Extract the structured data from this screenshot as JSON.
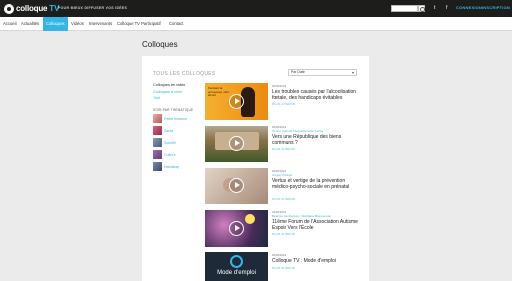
{
  "header": {
    "logo_text": "colloque",
    "logo_tv": "TV",
    "tagline": "POUR MIEUX DIFFUSER VOS IDÉES",
    "search_placeholder": "",
    "social": {
      "twitter": "t",
      "facebook": "f"
    },
    "login": "CONNEXION",
    "signup": "INSCRIPTION"
  },
  "nav": {
    "items": [
      {
        "label": "Accueil",
        "active": false
      },
      {
        "label": "Actualités",
        "active": false
      },
      {
        "label": "Colloques",
        "active": true
      },
      {
        "label": "Vidéos",
        "active": false
      },
      {
        "label": "Intervenants",
        "active": false
      },
      {
        "label": "Colloque TV Participatif",
        "active": false
      },
      {
        "label": "Contact",
        "active": false
      }
    ]
  },
  "page": {
    "title": "Colloques",
    "section_title": "TOUS LES COLLOQUES",
    "sort": {
      "selected": "Par Date"
    }
  },
  "sidebar": {
    "links": [
      {
        "label": "Colloques en vidéo",
        "current": true
      },
      {
        "label": "Colloques à venir",
        "current": false
      },
      {
        "label": "Tout",
        "current": false
      }
    ],
    "themes_heading": "VOIR PAR THÉMATIQUE",
    "themes": [
      {
        "label": "Petite enfance",
        "color": "#d98c8c"
      },
      {
        "label": "Santé",
        "color": "#c04a6a"
      },
      {
        "label": "Société",
        "color": "#6a7a9a"
      },
      {
        "label": "Culture",
        "color": "#8a5a9a"
      },
      {
        "label": "Handicap",
        "color": "#5a6a8a"
      }
    ]
  },
  "videos": [
    {
      "date": "18/06/2019",
      "author": "",
      "title": "Les troubles causés par l'alcoolisation fœtale, des handicaps évitables",
      "more": "PLUS D'INFOS",
      "thumb_color": "#f0a020",
      "thumb_text": "Pendant la grossesse, zéro alcool"
    },
    {
      "date": "18/06/2019",
      "author": "Centre Culturel International de Cerisy",
      "title": "Vers une République des biens communs ?",
      "more": "PLUS D'INFOS",
      "thumb_color": "#8a7a4a",
      "thumb_text": ""
    },
    {
      "date": "18/06/2019",
      "author": "Crepsy Périnat",
      "title": "Vertus et vertige de la prévention médico-psycho-sociale en prénatal",
      "more": "PLUS D'INFOS",
      "thumb_color": "#c8b8a8",
      "thumb_text": ""
    },
    {
      "date": "18/06/2019",
      "author": "Béatrice Lambertuon, Stéphane Bienvenuun",
      "title": "11ème Forum de l'Association Autisme Espoir Vers l'École",
      "more": "PLUS D'INFOS",
      "thumb_color": "#5a3a6a",
      "thumb_text": ""
    },
    {
      "date": "18/06/2019",
      "author": "",
      "title": "Colloque TV : Mode d'emploi",
      "more": "PLUS D'INFOS",
      "thumb_color": "#1e2a38",
      "thumb_text": "Mode d'emploi"
    }
  ]
}
